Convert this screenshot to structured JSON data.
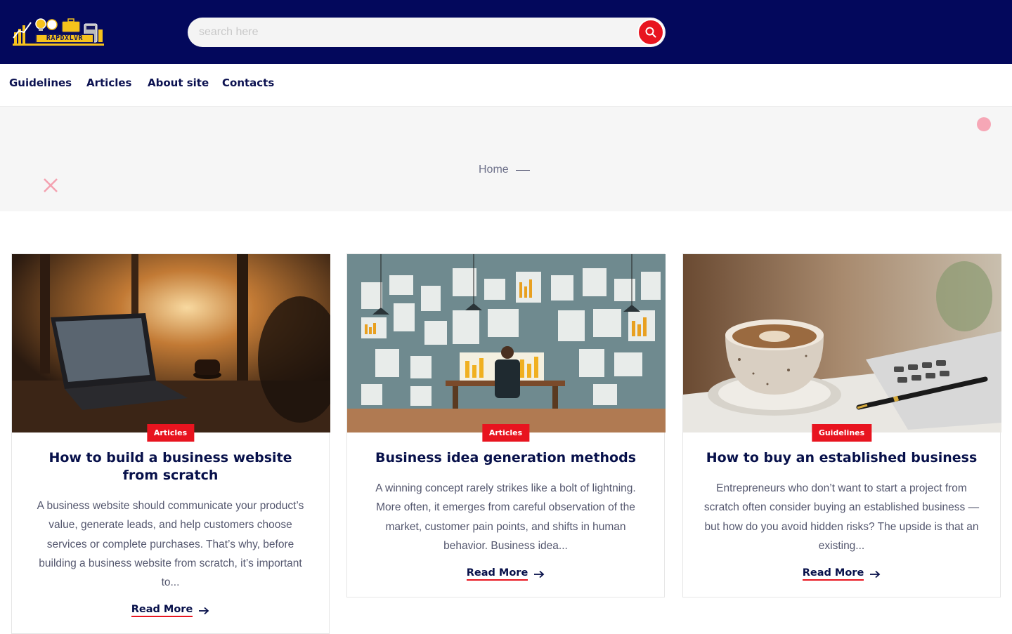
{
  "header": {
    "logo_text": "RAPDXLVR",
    "search_placeholder": "search here",
    "search_icon": "search-icon"
  },
  "nav": {
    "items": [
      {
        "label": "Guidelines"
      },
      {
        "label": "Articles"
      },
      {
        "label": "About site"
      },
      {
        "label": "Contacts"
      }
    ]
  },
  "hero": {
    "breadcrumb_home": "Home"
  },
  "colors": {
    "header_bg": "#03085c",
    "accent": "#e8141f",
    "title": "#07104a"
  },
  "cards": [
    {
      "category": "Articles",
      "title": "How to build a business website from scratch",
      "excerpt": "A business website should communicate your product’s value, generate leads, and help customers choose services or complete purchases. That’s why, before building a business website from scratch, it’s important to...",
      "read_more": "Read More"
    },
    {
      "category": "Articles",
      "title": "Business idea generation methods",
      "excerpt": "A winning concept rarely strikes like a bolt of lightning. More often, it emerges from careful observation of the market, customer pain points, and shifts in human behavior. Business idea...",
      "read_more": "Read More"
    },
    {
      "category": "Guidelines",
      "title": "How to buy an established business",
      "excerpt": "Entrepreneurs who don’t want to start a project from scratch often consider buying an established business — but how do you avoid hidden risks? The upside is that an existing...",
      "read_more": "Read More"
    }
  ]
}
